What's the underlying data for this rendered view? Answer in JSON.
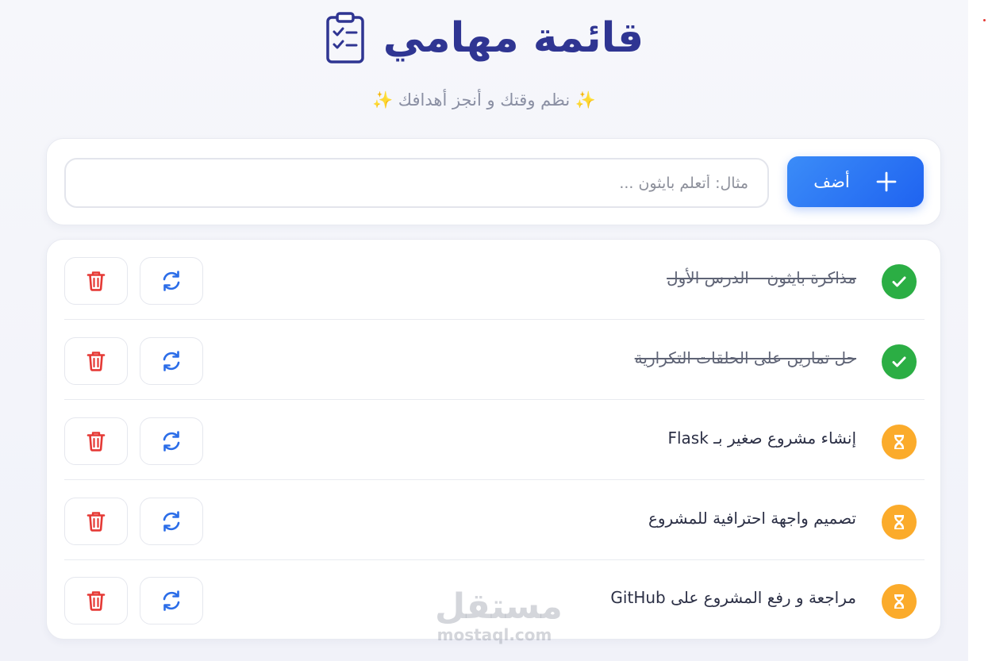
{
  "header": {
    "title": "قائمة مهامي",
    "icon": "clipboard-checklist-icon",
    "subtitle_spark": "✨",
    "subtitle": "نظم وقتك و أنجز أهدافك"
  },
  "add_form": {
    "button_label": "أضف",
    "button_icon": "plus-icon",
    "input_value": "",
    "input_placeholder": "مثال: أتعلم بايثون ..."
  },
  "tasks": [
    {
      "text": "مذاكرة بايثون – الدرس الأول",
      "status": "done"
    },
    {
      "text": "حل تمارين على الحلقات التكرارية",
      "status": "done"
    },
    {
      "text": "إنشاء مشروع صغير بـ Flask",
      "status": "pending"
    },
    {
      "text": "تصميم واجهة احترافية للمشروع",
      "status": "pending"
    },
    {
      "text": "مراجعة و رفع المشروع على GitHub",
      "status": "pending"
    }
  ],
  "icons": {
    "done": "check-circle-icon",
    "pending": "hourglass-icon",
    "toggle": "refresh-icon",
    "delete": "trash-icon"
  },
  "colors": {
    "accent": "#2563eb",
    "title": "#2f3592",
    "done": "#2bae44",
    "pending": "#fbab2b",
    "danger": "#e53935"
  },
  "watermark": {
    "arabic": "مستقل",
    "latin": "mostaql.com"
  }
}
